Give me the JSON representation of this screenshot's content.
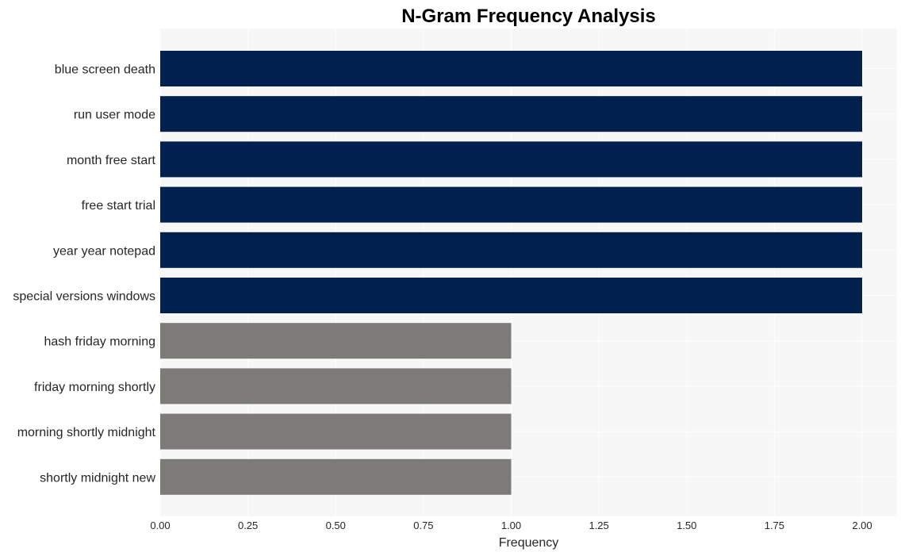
{
  "chart_data": {
    "type": "bar",
    "orientation": "horizontal",
    "title": "N-Gram Frequency Analysis",
    "xlabel": "Frequency",
    "ylabel": "",
    "xlim": [
      0,
      2.1
    ],
    "xticks": [
      0,
      0.25,
      0.5,
      0.75,
      1.0,
      1.25,
      1.5,
      1.75,
      2.0
    ],
    "xtick_labels": [
      "0.00",
      "0.25",
      "0.50",
      "0.75",
      "1.00",
      "1.25",
      "1.50",
      "1.75",
      "2.00"
    ],
    "grid": true,
    "categories": [
      "blue screen death",
      "run user mode",
      "month free start",
      "free start trial",
      "year year notepad",
      "special versions windows",
      "hash friday morning",
      "friday morning shortly",
      "morning shortly midnight",
      "shortly midnight new"
    ],
    "values": [
      2,
      2,
      2,
      2,
      2,
      2,
      1,
      1,
      1,
      1
    ],
    "colors": {
      "high": "#00214d",
      "low": "#7c7b77",
      "plot_background": "#f7f7f7",
      "grid": "#ffffff"
    }
  }
}
